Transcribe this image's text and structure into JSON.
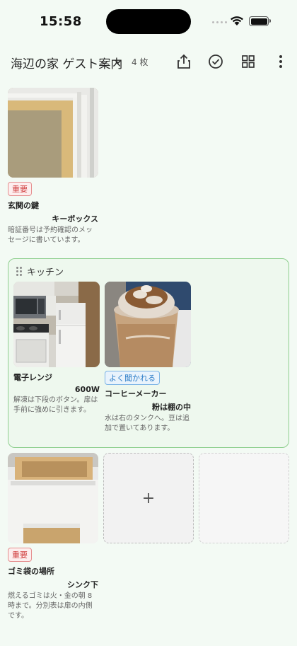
{
  "status": {
    "time": "15:58"
  },
  "header": {
    "title": "海辺の家 ゲスト案内",
    "count": "4 枚"
  },
  "cards": [
    {
      "badge": "重要",
      "title": "玄関の鍵",
      "subtitle": "キーボックス",
      "note": "暗証番号は予約確認のメッセージに書いています。"
    },
    {
      "title": "電子レンジ",
      "subtitle": "600W",
      "note": "解凍は下段のボタン。扉は手前に強めに引きます。"
    },
    {
      "badge": "よく聞かれる",
      "title": "コーヒーメーカー",
      "subtitle": "粉は棚の中",
      "note": "水は右のタンクへ。豆は追加で置いてあります。"
    },
    {
      "badge": "重要",
      "title": "ゴミ袋の場所",
      "subtitle": "シンク下",
      "note": "燃えるゴミは火・金の朝 8 時まで。分別表は扉の内側です。"
    }
  ],
  "group": {
    "title": "キッチン"
  },
  "add_label": "+",
  "colors": {
    "background": "#f3faf4",
    "group_border": "#8fcf8f",
    "important": "#d03b3b",
    "frequent": "#2f7fc8"
  }
}
